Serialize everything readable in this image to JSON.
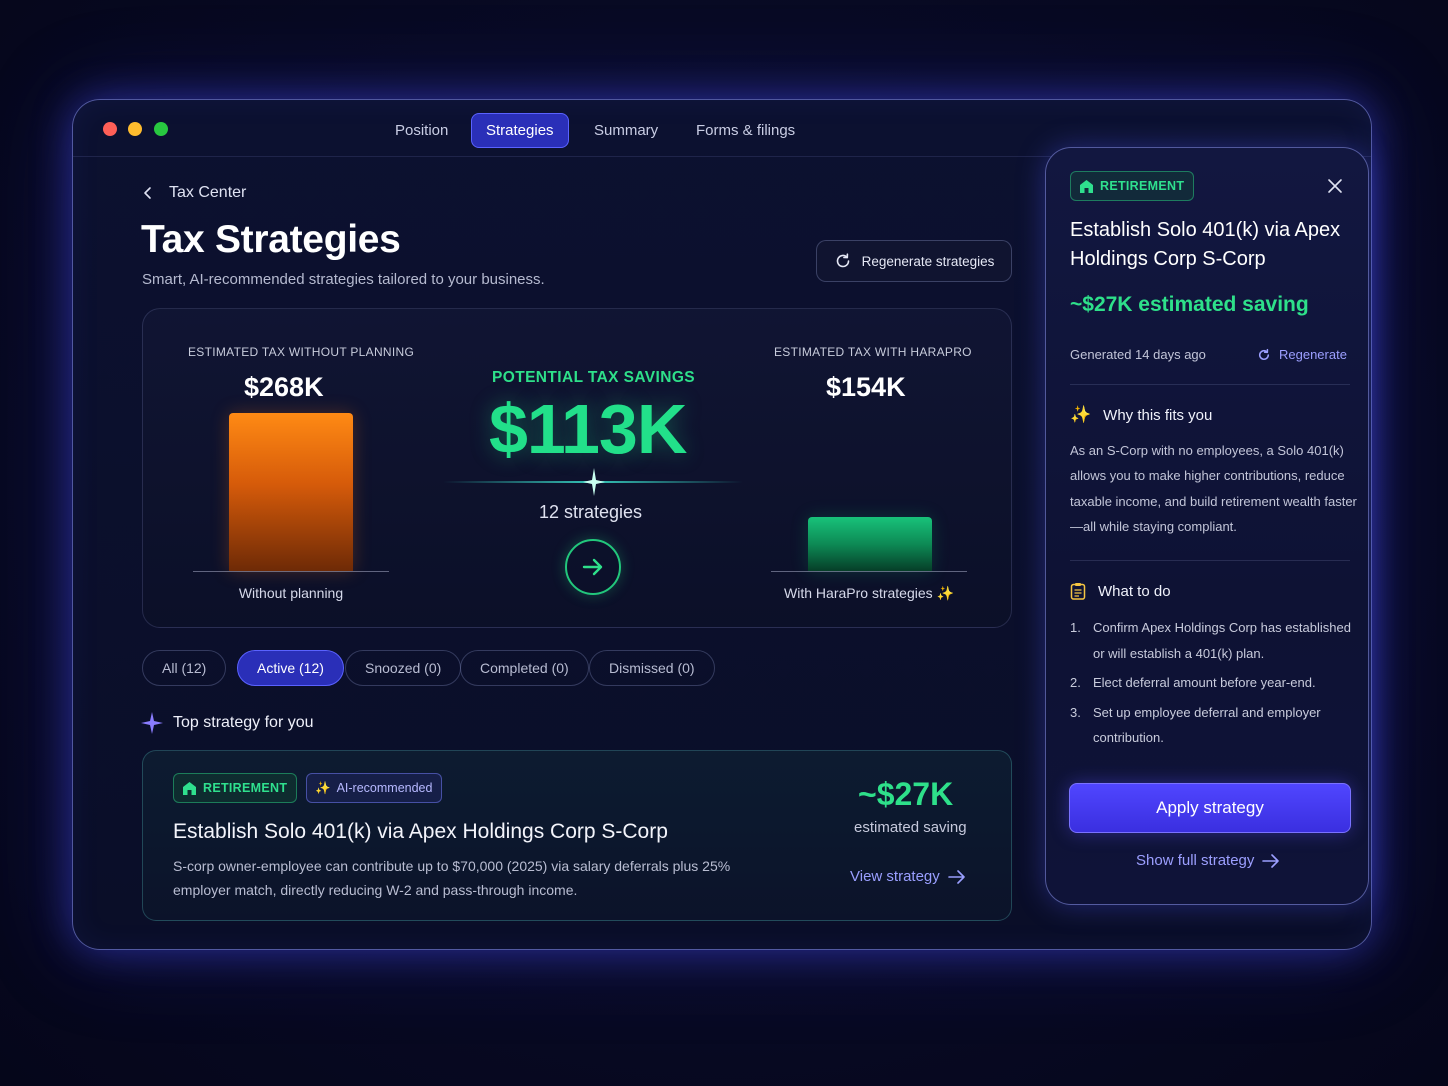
{
  "nav": {
    "tabs": [
      {
        "label": "Position"
      },
      {
        "label": "Strategies"
      },
      {
        "label": "Summary"
      },
      {
        "label": "Forms & filings"
      }
    ],
    "active_tab": "Strategies"
  },
  "header": {
    "breadcrumb": "Tax Center",
    "title": "Tax Strategies",
    "subtitle": "Smart, AI-recommended strategies tailored to your business.",
    "regenerate_label": "Regenerate strategies"
  },
  "summary": {
    "without": {
      "label": "ESTIMATED TAX WITHOUT PLANNING",
      "value": "$268K",
      "amount_k": 268,
      "caption": "Without planning"
    },
    "with": {
      "label": "ESTIMATED TAX WITH HARAPRO",
      "value": "$154K",
      "amount_k": 154,
      "caption": "With HaraPro strategies"
    },
    "potential_label": "POTENTIAL TAX SAVINGS",
    "potential_value": "$113K",
    "strategies_count": "12 strategies"
  },
  "filters": [
    {
      "label": "All (12)",
      "active": false
    },
    {
      "label": "Active (12)",
      "active": true
    },
    {
      "label": "Snoozed (0)",
      "active": false
    },
    {
      "label": "Completed (0)",
      "active": false
    },
    {
      "label": "Dismissed (0)",
      "active": false
    }
  ],
  "top_strategy": {
    "section_label": "Top strategy for you",
    "badge_category": "RETIREMENT",
    "badge_ai": "AI-recommended",
    "title": "Establish Solo 401(k) via Apex Holdings Corp S-Corp",
    "description": "S-corp owner-employee can contribute up to $70,000 (2025) via salary deferrals plus 25% employer match, directly reducing W-2 and pass-through income.",
    "saving": "~$27K",
    "saving_label": "estimated saving",
    "view_label": "View strategy"
  },
  "panel": {
    "badge": "RETIREMENT",
    "title": "Establish Solo 401(k) via Apex Holdings Corp S-Corp",
    "saving": "~$27K estimated saving",
    "generated": "Generated 14 days ago",
    "regenerate": "Regenerate",
    "why_heading": "Why this fits you",
    "why_body": "As an S-Corp with no employees, a Solo 401(k) allows you to make higher contributions, reduce taxable income, and build retirement wealth faster—all while staying compliant.",
    "todo_heading": "What to do",
    "steps": [
      {
        "num": "1.",
        "text": "Confirm Apex Holdings Corp has established or will establish a 401(k) plan."
      },
      {
        "num": "2.",
        "text": "Elect deferral amount before year-end."
      },
      {
        "num": "3.",
        "text": "Set up employee deferral and employer contribution."
      }
    ],
    "apply_label": "Apply strategy",
    "show_full_label": "Show full strategy"
  },
  "colors": {
    "accent": "#2a2fb8",
    "savings_green": "#2ee08a",
    "bar_orange": "#ff8a14",
    "bar_green": "#18c27a",
    "link": "#9c9fff"
  },
  "icons": [
    "back-chevron-icon",
    "refresh-icon",
    "arrow-right-icon",
    "sparkle-icon",
    "retirement-icon",
    "close-icon",
    "clipboard-icon"
  ]
}
